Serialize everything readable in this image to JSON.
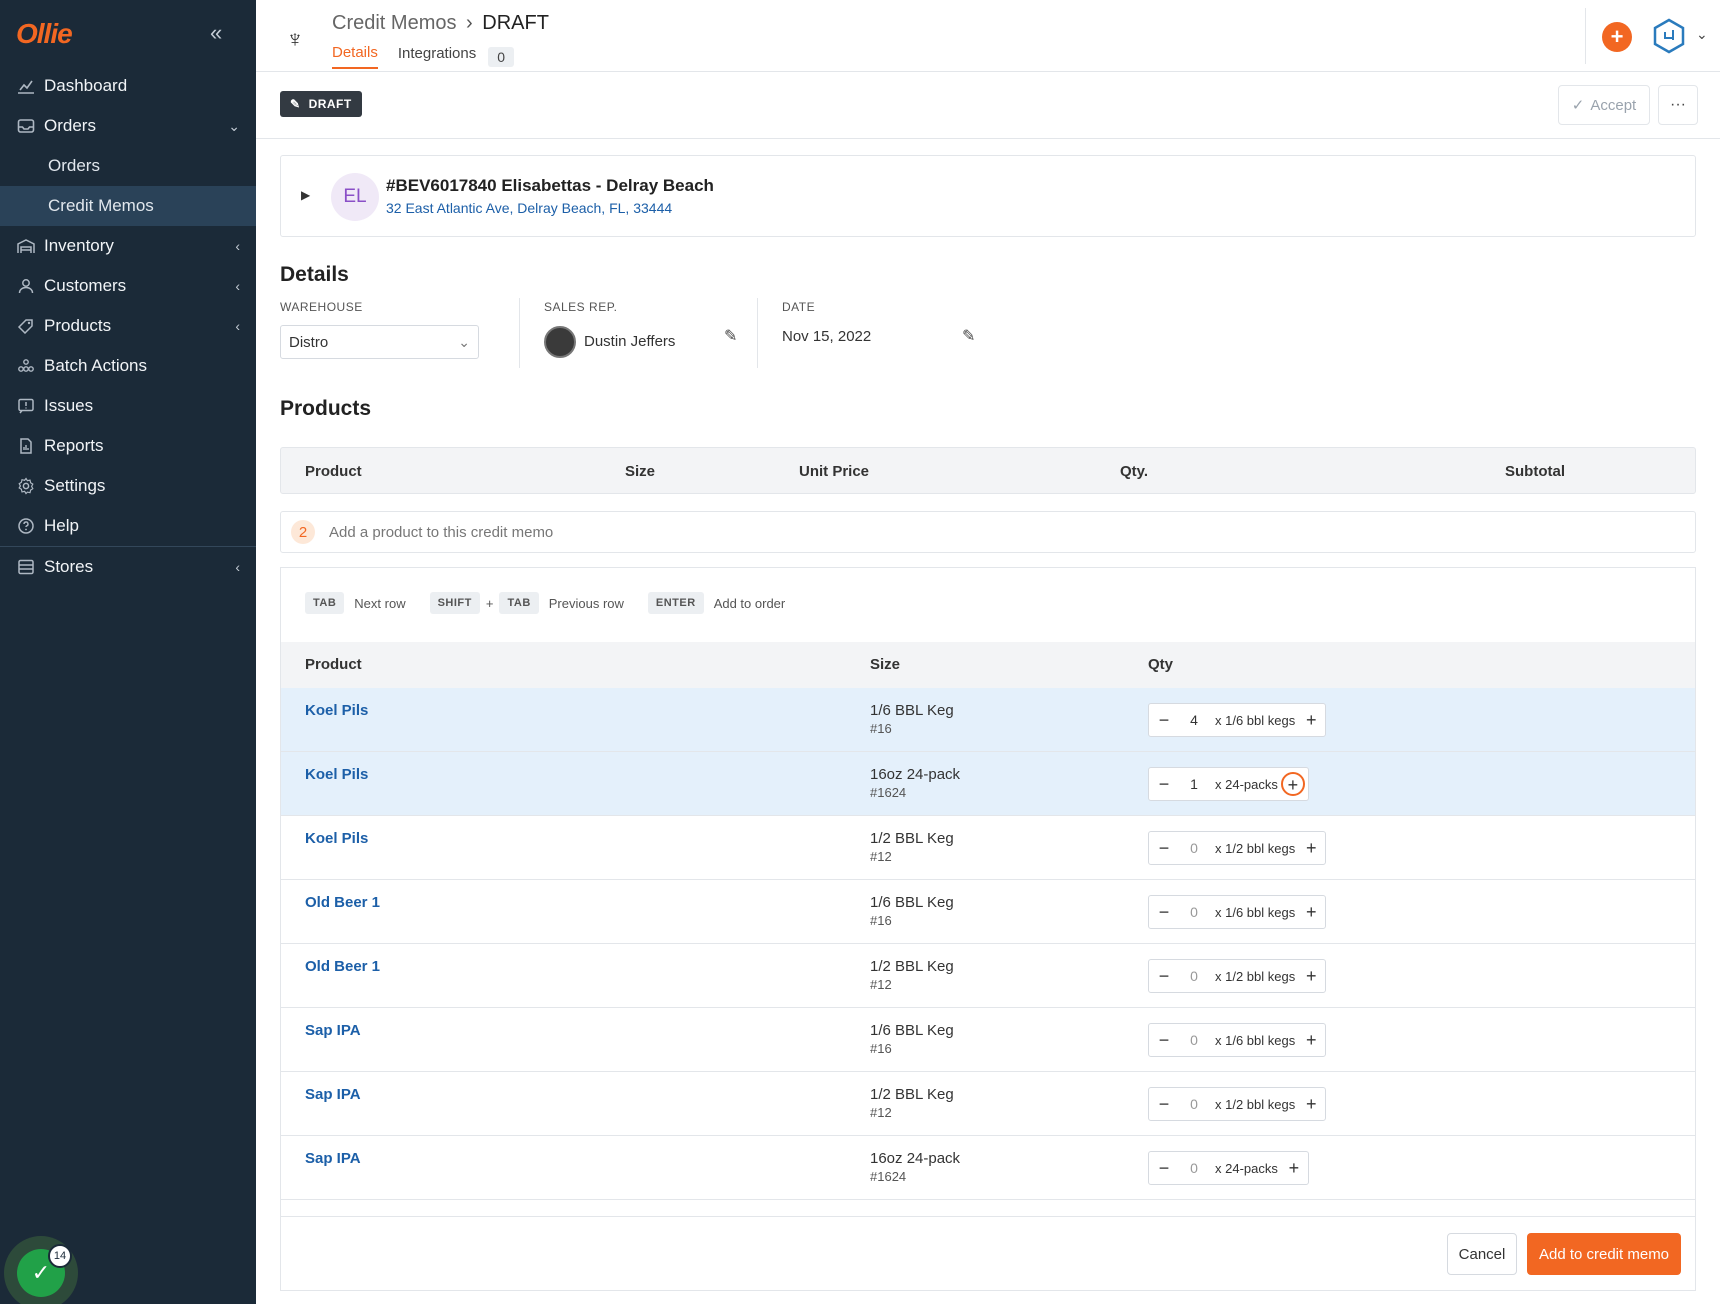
{
  "app": {
    "logo": "Ollie"
  },
  "colors": {
    "accent": "#f26722",
    "sidebar_bg": "#1b2a38",
    "link": "#1c5fa8",
    "selected_row": "#e4f0fb"
  },
  "sidebar": {
    "items": [
      {
        "label": "Dashboard",
        "icon": "chart-icon"
      },
      {
        "label": "Orders",
        "icon": "inbox-icon"
      },
      {
        "label": "Inventory",
        "icon": "warehouse-icon"
      },
      {
        "label": "Customers",
        "icon": "person-icon"
      },
      {
        "label": "Products",
        "icon": "tag-icon"
      },
      {
        "label": "Batch Actions",
        "icon": "stack-icon"
      },
      {
        "label": "Issues",
        "icon": "alert-icon"
      },
      {
        "label": "Reports",
        "icon": "report-icon"
      },
      {
        "label": "Settings",
        "icon": "gear-icon"
      },
      {
        "label": "Help",
        "icon": "help-icon"
      },
      {
        "label": "Stores",
        "icon": "store-icon"
      }
    ],
    "orders_sub": [
      {
        "label": "Orders"
      },
      {
        "label": "Credit Memos"
      }
    ],
    "notification_count": "14"
  },
  "header": {
    "breadcrumb_parent": "Credit Memos",
    "breadcrumb_current": "DRAFT",
    "tabs": [
      {
        "label": "Details"
      },
      {
        "label": "Integrations"
      }
    ],
    "integrations_count": "0"
  },
  "status": {
    "badge": "DRAFT",
    "accept_label": "Accept",
    "more_label": "···"
  },
  "customer": {
    "initials": "EL",
    "name": "#BEV6017840 Elisabettas - Delray Beach",
    "address": "32 East Atlantic Ave, Delray Beach, FL, 33444"
  },
  "details": {
    "title": "Details",
    "warehouse_label": "WAREHOUSE",
    "warehouse_value": "Distro",
    "salesrep_label": "SALES REP.",
    "salesrep_name": "Dustin Jeffers",
    "date_label": "DATE",
    "date_value": "Nov 15, 2022"
  },
  "products": {
    "title": "Products",
    "columns": {
      "product": "Product",
      "size": "Size",
      "unit_price": "Unit Price",
      "qty": "Qty.",
      "subtotal": "Subtotal"
    },
    "add_step": "2",
    "add_placeholder": "Add a product to this credit memo"
  },
  "picker": {
    "hints": {
      "tab": "TAB",
      "next_row": "Next row",
      "shift": "SHIFT",
      "plus": "+",
      "tab2": "TAB",
      "prev_row": "Previous row",
      "enter": "ENTER",
      "add_to_order": "Add to order"
    },
    "columns": {
      "product": "Product",
      "size": "Size",
      "qty": "Qty"
    },
    "rows": [
      {
        "product": "Koel Pils",
        "size": "1/6 BBL Keg",
        "sku": "#16",
        "qty": "4",
        "unit": "x 1/6 bbl kegs"
      },
      {
        "product": "Koel Pils",
        "size": "16oz 24-pack",
        "sku": "#1624",
        "qty": "1",
        "unit": "x 24-packs"
      },
      {
        "product": "Koel Pils",
        "size": "1/2 BBL Keg",
        "sku": "#12",
        "qty": "0",
        "unit": "x 1/2 bbl kegs"
      },
      {
        "product": "Old Beer 1",
        "size": "1/6 BBL Keg",
        "sku": "#16",
        "qty": "0",
        "unit": "x 1/6 bbl kegs"
      },
      {
        "product": "Old Beer 1",
        "size": "1/2 BBL Keg",
        "sku": "#12",
        "qty": "0",
        "unit": "x 1/2 bbl kegs"
      },
      {
        "product": "Sap IPA",
        "size": "1/6 BBL Keg",
        "sku": "#16",
        "qty": "0",
        "unit": "x 1/6 bbl kegs"
      },
      {
        "product": "Sap IPA",
        "size": "1/2 BBL Keg",
        "sku": "#12",
        "qty": "0",
        "unit": "x 1/2 bbl kegs"
      },
      {
        "product": "Sap IPA",
        "size": "16oz 24-pack",
        "sku": "#1624",
        "qty": "0",
        "unit": "x 24-packs"
      }
    ],
    "cancel_label": "Cancel",
    "submit_label": "Add to credit memo"
  }
}
